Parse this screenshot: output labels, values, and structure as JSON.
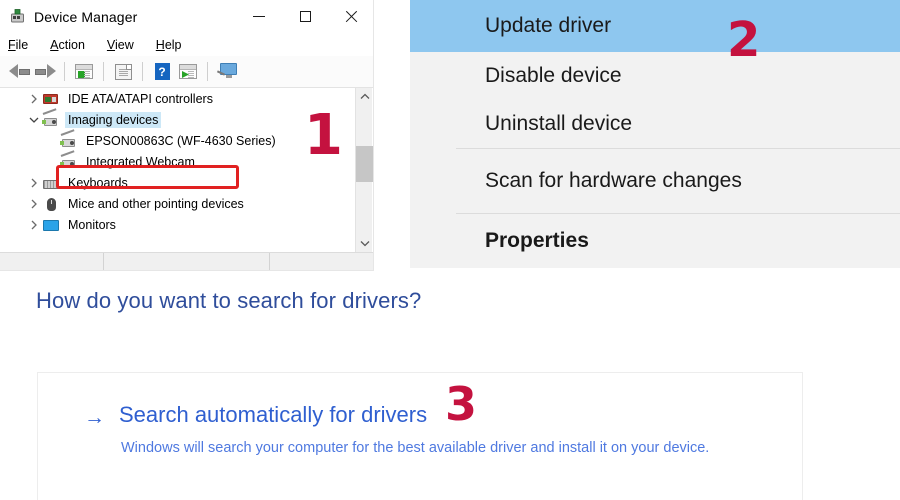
{
  "device_manager": {
    "title": "Device Manager",
    "app_icon": "device-manager-icon",
    "window_buttons": {
      "minimize": "–",
      "maximize": "□",
      "close": "✕"
    },
    "menus": [
      {
        "label": "File",
        "accel": "F"
      },
      {
        "label": "Action",
        "accel": "A"
      },
      {
        "label": "View",
        "accel": "V"
      },
      {
        "label": "Help",
        "accel": "H"
      }
    ],
    "toolbar": [
      {
        "name": "back-button",
        "icon": "back-arrow-icon"
      },
      {
        "name": "forward-button",
        "icon": "forward-arrow-icon"
      },
      {
        "name": "properties-button",
        "icon": "properties-window-icon"
      },
      {
        "name": "update-driver-button",
        "icon": "document-icon"
      },
      {
        "name": "help-button",
        "icon": "help-question-icon"
      },
      {
        "name": "enable-device-button",
        "icon": "play-window-icon"
      },
      {
        "name": "scan-hardware-button",
        "icon": "monitor-scan-icon"
      }
    ],
    "tree": [
      {
        "label": "IDE ATA/ATAPI controllers",
        "icon": "ide-controller-icon",
        "expander": "collapsed",
        "indent": 0,
        "selected": false
      },
      {
        "label": "Imaging devices",
        "icon": "imaging-device-icon",
        "expander": "expanded",
        "indent": 0,
        "selected": true
      },
      {
        "label": "EPSON00863C (WF-4630 Series)",
        "icon": "imaging-device-icon",
        "expander": "none",
        "indent": 1,
        "selected": false
      },
      {
        "label": "Integrated Webcam",
        "icon": "imaging-device-icon",
        "expander": "none",
        "indent": 1,
        "selected": false,
        "highlighted": true
      },
      {
        "label": "Keyboards",
        "icon": "keyboard-icon",
        "expander": "collapsed",
        "indent": 0,
        "selected": false
      },
      {
        "label": "Mice and other pointing devices",
        "icon": "mouse-icon",
        "expander": "collapsed",
        "indent": 0,
        "selected": false
      },
      {
        "label": "Monitors",
        "icon": "monitor-icon",
        "expander": "collapsed",
        "indent": 0,
        "selected": false
      }
    ],
    "highlight_color": "#cde8f7",
    "callout_box_color": "#e12121"
  },
  "context_menu": {
    "items": [
      {
        "label": "Update driver",
        "highlighted": true,
        "bold": false,
        "separator_after": false
      },
      {
        "label": "Disable device",
        "highlighted": false,
        "bold": false,
        "separator_after": false
      },
      {
        "label": "Uninstall device",
        "highlighted": false,
        "bold": false,
        "separator_after": true
      },
      {
        "label": "Scan for hardware changes",
        "highlighted": false,
        "bold": false,
        "separator_after": true
      },
      {
        "label": "Properties",
        "highlighted": false,
        "bold": true,
        "separator_after": false
      }
    ],
    "highlight_color": "#8ec7ef",
    "background_color": "#f2f2f2"
  },
  "wizard": {
    "heading": "How do you want to search for drivers?",
    "heading_color": "#2f4d9b",
    "arrow_glyph": "→",
    "option_label": "Search automatically for drivers",
    "option_description": "Windows will search your computer for the best available driver and install it on your device.",
    "link_color": "#2f5fd0"
  },
  "markers": {
    "color": "#c4123f",
    "one": "1",
    "two": "2",
    "three": "3"
  }
}
